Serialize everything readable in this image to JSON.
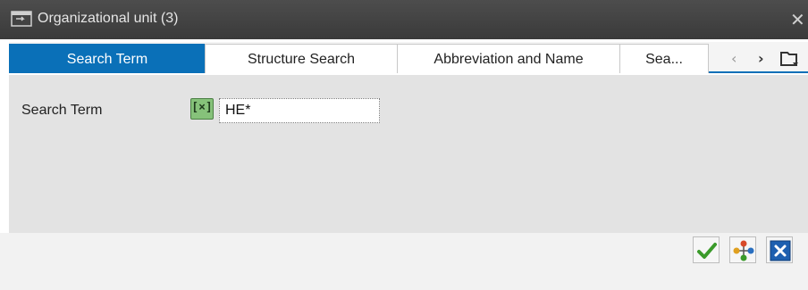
{
  "window": {
    "title": "Organizational unit (3)",
    "close_glyph": "✕",
    "icon": "dialog-icon"
  },
  "tabs": [
    {
      "label": "Search Term",
      "active": true
    },
    {
      "label": "Structure Search",
      "active": false
    },
    {
      "label": "Abbreviation and Name",
      "active": false
    },
    {
      "label": "Sea...",
      "active": false
    }
  ],
  "tab_nav": {
    "prev_glyph": "‹",
    "next_glyph": "›",
    "menu_icon": "tab-list-icon"
  },
  "form": {
    "search_term_label": "Search Term",
    "select_icon_glyph": "[×]",
    "search_term_value": "HE*"
  },
  "footer_buttons": [
    {
      "name": "ok",
      "icon": "checkmark-icon"
    },
    {
      "name": "hierarchy",
      "icon": "hierarchy-icon"
    },
    {
      "name": "cancel",
      "icon": "cancel-icon"
    }
  ],
  "colors": {
    "titlebar": "#3f3f3f",
    "accent": "#0a70b8",
    "content_bg": "#e3e3e3",
    "select_icon_green": "#86c27a",
    "cancel_blue": "#1d5fb0",
    "ok_green": "#3a9a2a"
  }
}
